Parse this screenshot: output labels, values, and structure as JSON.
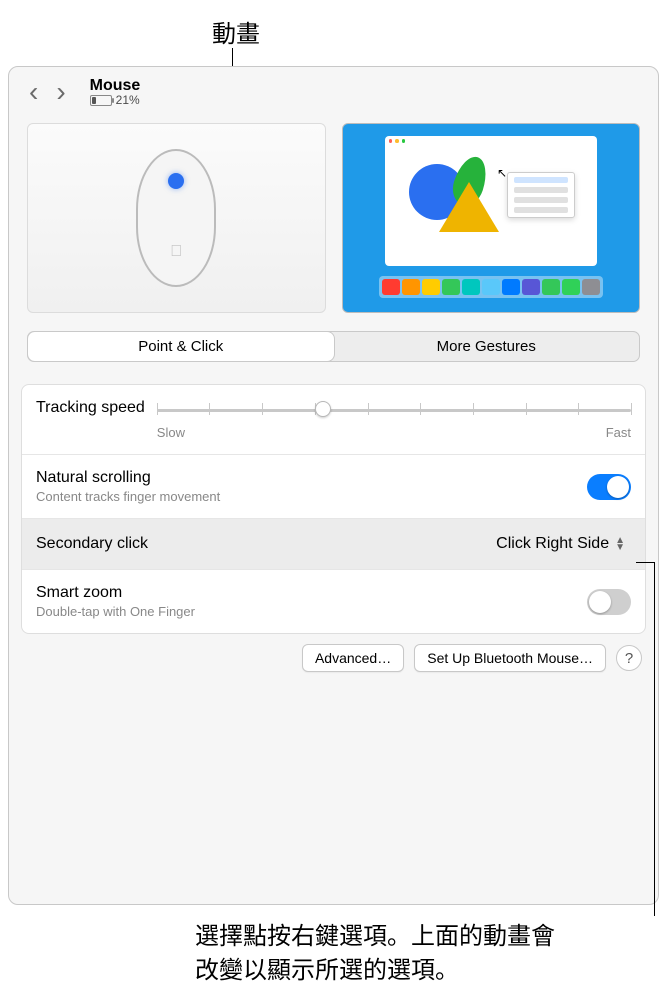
{
  "annotations": {
    "top": "動畫",
    "bottom_line1": "選擇點按右鍵選項。上面的動畫會",
    "bottom_line2": "改變以顯示所選的選項。"
  },
  "header": {
    "title": "Mouse",
    "battery_percent": "21%"
  },
  "tabs": {
    "point_click": "Point & Click",
    "more_gestures": "More Gestures"
  },
  "settings": {
    "tracking": {
      "label": "Tracking speed",
      "slow": "Slow",
      "fast": "Fast",
      "value_pct": 35
    },
    "natural_scrolling": {
      "label": "Natural scrolling",
      "sublabel": "Content tracks finger movement",
      "on": true
    },
    "secondary_click": {
      "label": "Secondary click",
      "value": "Click Right Side"
    },
    "smart_zoom": {
      "label": "Smart zoom",
      "sublabel": "Double-tap with One Finger",
      "on": false
    }
  },
  "footer": {
    "advanced": "Advanced…",
    "setup_bt": "Set Up Bluetooth Mouse…",
    "help": "?"
  },
  "dock_colors": [
    "#ff3b30",
    "#ff9500",
    "#ffcc00",
    "#34c759",
    "#00c7be",
    "#5ac8fa",
    "#007aff",
    "#5856d6",
    "#34c759",
    "#30d158",
    "#8e8e93"
  ]
}
